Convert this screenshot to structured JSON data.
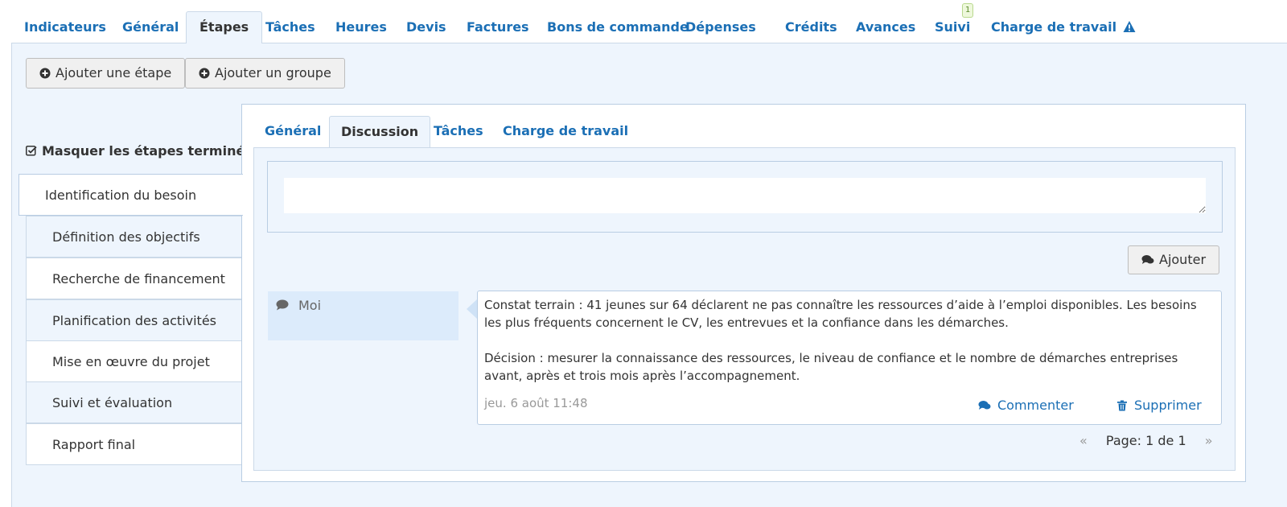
{
  "top_tabs": [
    {
      "label": "Indicateurs",
      "active": false
    },
    {
      "label": "Général",
      "active": false
    },
    {
      "label": "Étapes",
      "active": true
    },
    {
      "label": "Tâches",
      "active": false
    },
    {
      "label": "Heures",
      "active": false
    },
    {
      "label": "Devis",
      "active": false
    },
    {
      "label": "Factures",
      "active": false
    },
    {
      "label": "Bons de commande",
      "active": false
    },
    {
      "label": "Dépenses",
      "active": false
    },
    {
      "label": "Crédits",
      "active": false
    },
    {
      "label": "Avances",
      "active": false
    },
    {
      "label": "Suivi",
      "active": false,
      "badge": "1"
    },
    {
      "label": "Charge de travail",
      "active": false,
      "icon": "warning-icon"
    }
  ],
  "toolbar": {
    "add_step_label": "Ajouter une étape",
    "add_group_label": "Ajouter un groupe",
    "add_icon": "plus-circle-icon"
  },
  "steps_panel": {
    "hide_done_label": "Masquer les étapes terminées",
    "hide_done_checked": true,
    "steps": [
      {
        "label": "Identification du besoin",
        "active": true
      },
      {
        "label": "Définition des objectifs",
        "active": false
      },
      {
        "label": "Recherche de financement",
        "active": false
      },
      {
        "label": "Planification des activités",
        "active": false
      },
      {
        "label": "Mise en œuvre du projet",
        "active": false
      },
      {
        "label": "Suivi et évaluation",
        "active": false
      },
      {
        "label": "Rapport final",
        "active": false
      }
    ]
  },
  "detail": {
    "tabs": [
      {
        "label": "Général",
        "active": false
      },
      {
        "label": "Discussion",
        "active": true
      },
      {
        "label": "Tâches",
        "active": false
      },
      {
        "label": "Charge de travail",
        "active": false
      }
    ],
    "comment_input": {
      "value": "",
      "placeholder": ""
    },
    "add_button_label": "Ajouter",
    "messages": [
      {
        "author": "Moi",
        "paragraphs": [
          "Constat terrain : 41 jeunes sur 64 déclarent ne pas connaître les ressources d’aide à l’emploi disponibles. Les besoins les plus fréquents concernent le CV, les entrevues et la confiance dans les démarches.",
          "Décision : mesurer la connaissance des ressources, le niveau de confiance et le nombre de démarches entreprises avant, après et trois mois après l’accompagnement."
        ],
        "date": "jeu. 6 août 11:48",
        "comment_label": "Commenter",
        "delete_label": "Supprimer"
      }
    ],
    "pager": {
      "prev": "«",
      "text": "Page: 1 de 1",
      "next": "»"
    }
  },
  "colors": {
    "link": "#1b6fb5",
    "panel_bg": "#eef5fd",
    "border": "#cbd9e8",
    "badge_bg": "#eef8dc"
  }
}
